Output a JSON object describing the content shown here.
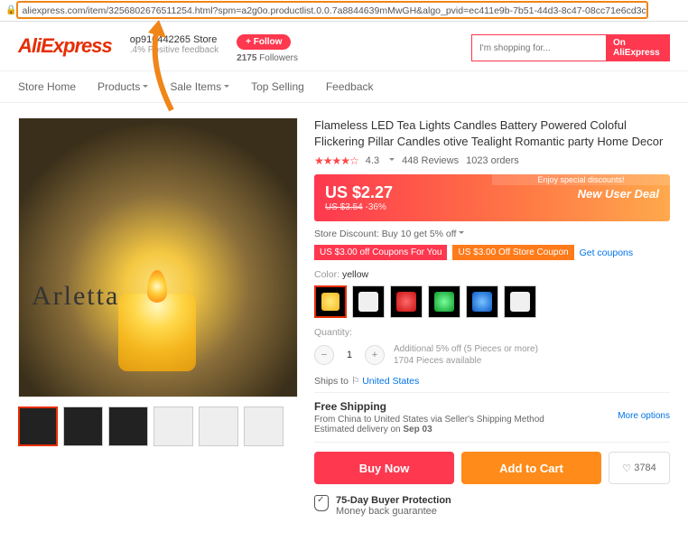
{
  "url": "aliexpress.com/item/3256802676511254.html?spm=a2g0o.productlist.0.0.7a8844639mMwGH&algo_pvid=ec411e9b-7b51-44d3-8c47-08cc71e6cd3c",
  "logo": "AliExpress",
  "store": {
    "name": "op910442265 Store",
    "feedback_pct": ".4%",
    "feedback_label": "Positive feedback"
  },
  "follow": {
    "btn": "+ Follow",
    "count": "2175",
    "label": "Followers"
  },
  "search": {
    "placeholder": "I'm shopping for...",
    "button": "On AliExpress"
  },
  "nav": [
    "Store Home",
    "Products",
    "Sale Items",
    "Top Selling",
    "Feedback"
  ],
  "product": {
    "title": "Flameless LED Tea Lights Candles Battery Powered Coloful Flickering Pillar Candles otive Tealight Romantic party Home Decor",
    "rating": "4.3",
    "reviews": "448 Reviews",
    "orders": "1023 orders",
    "price_banner": "Enjoy special discounts!",
    "price": "US $2.27",
    "old_price": "US $3.54",
    "discount": "-36%",
    "deal_badge": "New User Deal",
    "store_discount": "Store Discount: Buy 10 get 5% off",
    "coupon1": "US $3.00 off Coupons For You",
    "coupon2": "US $3.00 Off Store Coupon",
    "get_coupons": "Get coupons",
    "color_label": "Color:",
    "color_value": "yellow",
    "qty_label": "Quantity:",
    "qty": "1",
    "qty_note1": "Additional 5% off (5 Pieces or more)",
    "qty_note2": "1704 Pieces available",
    "ships_to_label": "Ships to",
    "ships_to": "United States",
    "shipping_title": "Free Shipping",
    "shipping_from": "From China to United States via Seller's Shipping Method",
    "shipping_est_label": "Estimated delivery on ",
    "shipping_est": "Sep 03",
    "more_options": "More options",
    "buy": "Buy Now",
    "cart": "Add to Cart",
    "likes": "3784",
    "protection_title": "75-Day Buyer Protection",
    "protection_sub": "Money back guarantee"
  }
}
